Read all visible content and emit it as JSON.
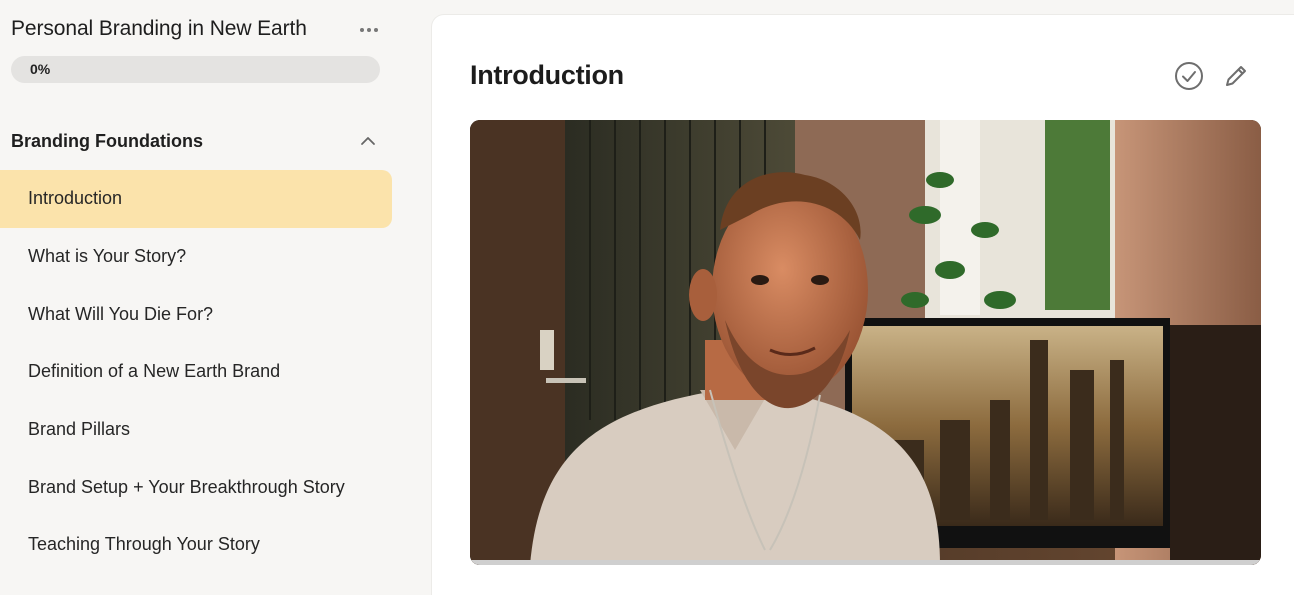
{
  "course": {
    "title": "Personal Branding in New Earth",
    "progress_text": "0%",
    "progress_value": 0
  },
  "sidebar": {
    "section": {
      "title": "Branding Foundations",
      "expanded": true
    },
    "lessons": [
      {
        "label": "Introduction",
        "active": true
      },
      {
        "label": "What is Your Story?"
      },
      {
        "label": "What Will You Die For?"
      },
      {
        "label": "Definition of a New Earth Brand"
      },
      {
        "label": "Brand Pillars"
      },
      {
        "label": "Brand Setup + Your Breakthrough Story"
      },
      {
        "label": "Teaching Through Your Story"
      }
    ]
  },
  "main": {
    "title": "Introduction"
  },
  "icons": {
    "more": "ellipsis-icon",
    "collapse": "chevron-up-icon",
    "complete": "check-circle-icon",
    "edit": "pencil-icon"
  },
  "colors": {
    "active_lesson_bg": "#fbe3ab",
    "progress_track": "#e4e3e1",
    "sidebar_bg": "#f7f6f4"
  }
}
